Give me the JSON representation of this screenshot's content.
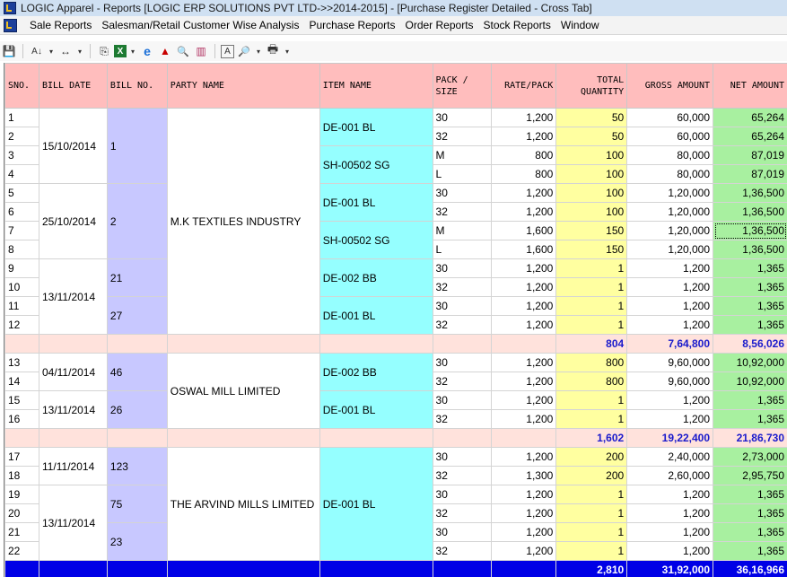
{
  "window": {
    "title": "LOGIC Apparel - Reports  [LOGIC ERP SOLUTIONS PVT LTD->>2014-2015] - [Purchase Register Detailed - Cross Tab]"
  },
  "menu": [
    "Sale Reports",
    "Salesman/Retail Customer Wise Analysis",
    "Purchase Reports",
    "Order Reports",
    "Stock Reports",
    "Window"
  ],
  "toolbar": {
    "icons": [
      "save-icon",
      "sort-icon",
      "column-width-icon",
      "copy-icon",
      "excel-icon",
      "ie-icon",
      "up-arrow-icon",
      "binoculars-icon",
      "chart-icon",
      "font-icon",
      "print-preview-icon",
      "print-icon"
    ],
    "glyphs": {
      "save": "💾",
      "sort": "A↓",
      "width": "↔",
      "copy": "⎘",
      "excel": "X",
      "ie": "e",
      "up": "▲",
      "find": "🔍",
      "chart": "▥",
      "font": "A",
      "preview": "🔎",
      "print": "🖶",
      "dd": "▾"
    }
  },
  "table": {
    "columns": [
      "SNO.",
      "BILL DATE",
      "BILL NO.",
      "PARTY NAME",
      "ITEM NAME",
      "PACK / SIZE",
      "RATE/PACK",
      "TOTAL QUANTITY",
      "GROSS AMOUNT",
      "NET AMOUNT"
    ],
    "rows": [
      {
        "sno": "1",
        "size": "30",
        "rate": "1,200",
        "qty": "50",
        "gross": "60,000",
        "net": "65,264"
      },
      {
        "sno": "2",
        "size": "32",
        "rate": "1,200",
        "qty": "50",
        "gross": "60,000",
        "net": "65,264"
      },
      {
        "sno": "3",
        "size": "M",
        "rate": "800",
        "qty": "100",
        "gross": "80,000",
        "net": "87,019"
      },
      {
        "sno": "4",
        "size": "L",
        "rate": "800",
        "qty": "100",
        "gross": "80,000",
        "net": "87,019"
      },
      {
        "sno": "5",
        "size": "30",
        "rate": "1,200",
        "qty": "100",
        "gross": "1,20,000",
        "net": "1,36,500"
      },
      {
        "sno": "6",
        "size": "32",
        "rate": "1,200",
        "qty": "100",
        "gross": "1,20,000",
        "net": "1,36,500"
      },
      {
        "sno": "7",
        "size": "M",
        "rate": "1,600",
        "qty": "150",
        "gross": "1,20,000",
        "net": "1,36,500"
      },
      {
        "sno": "8",
        "size": "L",
        "rate": "1,600",
        "qty": "150",
        "gross": "1,20,000",
        "net": "1,36,500"
      },
      {
        "sno": "9",
        "size": "30",
        "rate": "1,200",
        "qty": "1",
        "gross": "1,200",
        "net": "1,365"
      },
      {
        "sno": "10",
        "size": "32",
        "rate": "1,200",
        "qty": "1",
        "gross": "1,200",
        "net": "1,365"
      },
      {
        "sno": "11",
        "size": "30",
        "rate": "1,200",
        "qty": "1",
        "gross": "1,200",
        "net": "1,365"
      },
      {
        "sno": "12",
        "size": "32",
        "rate": "1,200",
        "qty": "1",
        "gross": "1,200",
        "net": "1,365"
      },
      {
        "sno": "13",
        "size": "30",
        "rate": "1,200",
        "qty": "800",
        "gross": "9,60,000",
        "net": "10,92,000"
      },
      {
        "sno": "14",
        "size": "32",
        "rate": "1,200",
        "qty": "800",
        "gross": "9,60,000",
        "net": "10,92,000"
      },
      {
        "sno": "15",
        "size": "30",
        "rate": "1,200",
        "qty": "1",
        "gross": "1,200",
        "net": "1,365"
      },
      {
        "sno": "16",
        "size": "32",
        "rate": "1,200",
        "qty": "1",
        "gross": "1,200",
        "net": "1,365"
      },
      {
        "sno": "17",
        "size": "30",
        "rate": "1,200",
        "qty": "200",
        "gross": "2,40,000",
        "net": "2,73,000"
      },
      {
        "sno": "18",
        "size": "32",
        "rate": "1,300",
        "qty": "200",
        "gross": "2,60,000",
        "net": "2,95,750"
      },
      {
        "sno": "19",
        "size": "30",
        "rate": "1,200",
        "qty": "1",
        "gross": "1,200",
        "net": "1,365"
      },
      {
        "sno": "20",
        "size": "32",
        "rate": "1,200",
        "qty": "1",
        "gross": "1,200",
        "net": "1,365"
      },
      {
        "sno": "21",
        "size": "30",
        "rate": "1,200",
        "qty": "1",
        "gross": "1,200",
        "net": "1,365"
      },
      {
        "sno": "22",
        "size": "32",
        "rate": "1,200",
        "qty": "1",
        "gross": "1,200",
        "net": "1,365"
      }
    ],
    "merged": {
      "dates": [
        "15/10/2014",
        "25/10/2014",
        "13/11/2014",
        "04/11/2014",
        "13/11/2014",
        "11/11/2014",
        "13/11/2014"
      ],
      "bills": [
        "1",
        "2",
        "21",
        "27",
        "46",
        "26",
        "123",
        "75",
        "23"
      ],
      "parties": [
        "M.K TEXTILES INDUSTRY",
        "OSWAL MILL LIMITED",
        "THE ARVIND MILLS LIMITED"
      ],
      "items": [
        "DE-001 BL",
        "SH-00502 SG",
        "DE-001 BL",
        "SH-00502 SG",
        "DE-002 BB",
        "DE-001 BL",
        "DE-002 BB",
        "DE-001 BL",
        "DE-001 BL"
      ]
    },
    "subtotals": [
      {
        "qty": "804",
        "gross": "7,64,800",
        "net": "8,56,026"
      },
      {
        "qty": "1,602",
        "gross": "19,22,400",
        "net": "21,86,730"
      }
    ],
    "grand_total": {
      "qty": "2,810",
      "gross": "31,92,000",
      "net": "36,16,966"
    }
  },
  "colors": {
    "header": "#ffbdbd",
    "bill_no": "#c8c8ff",
    "item": "#95ffff",
    "qty": "#ffffa0",
    "net": "#a8f0a0",
    "subtotal": "#ffe2dc",
    "grand_total": "#0000e6"
  }
}
